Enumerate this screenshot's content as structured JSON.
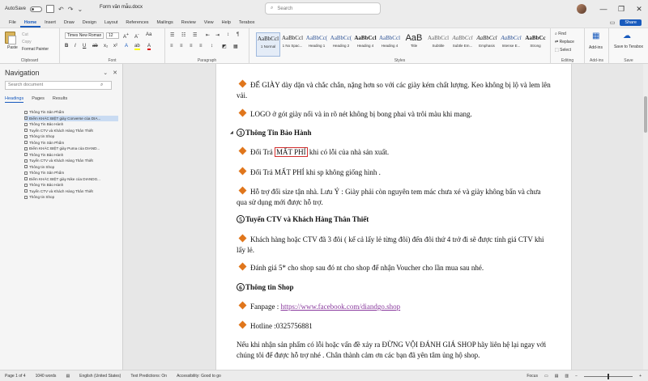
{
  "titlebar": {
    "autosave": "AutoSave",
    "toggle": "Off",
    "doc_title": "Form văn mẫu.docx",
    "search_placeholder": "Search"
  },
  "tabs": [
    {
      "label": "File"
    },
    {
      "label": "Home",
      "active": true
    },
    {
      "label": "Insert"
    },
    {
      "label": "Draw"
    },
    {
      "label": "Design"
    },
    {
      "label": "Layout"
    },
    {
      "label": "References"
    },
    {
      "label": "Mailings"
    },
    {
      "label": "Review"
    },
    {
      "label": "View"
    },
    {
      "label": "Help"
    },
    {
      "label": "Terabox"
    }
  ],
  "share_label": "Share",
  "ribbon": {
    "clipboard": {
      "paste": "Paste",
      "cut": "Cut",
      "copy": "Copy",
      "format_painter": "Format Painter",
      "label": "Clipboard"
    },
    "font": {
      "name": "Times New Roman",
      "size": "12",
      "label": "Font"
    },
    "paragraph": {
      "label": "Paragraph"
    },
    "styles": {
      "label": "Styles",
      "items": [
        {
          "preview": "AaBbCcl",
          "name": "1 Normal"
        },
        {
          "preview": "AaBbCcl",
          "name": "1 No Spac..."
        },
        {
          "preview": "AaBbCc(",
          "name": "Heading 1",
          "heading": true
        },
        {
          "preview": "AaBbCc(",
          "name": "Heading 2",
          "heading": true
        },
        {
          "preview": "AaBbCcl",
          "name": "Heading 4"
        },
        {
          "preview": "AaBbCcl",
          "name": "Heading 4"
        },
        {
          "preview": "AaB",
          "name": "Title"
        },
        {
          "preview": "AaBbCcl",
          "name": "Subtitle"
        },
        {
          "preview": "AaBbCcl",
          "name": "Subtle Em..."
        },
        {
          "preview": "AaBbCcl",
          "name": "Emphasis"
        },
        {
          "preview": "AaBbCcl",
          "name": "Intense E..."
        },
        {
          "preview": "AaBbCc",
          "name": "Strong"
        }
      ]
    },
    "editing": {
      "find": "Find",
      "replace": "Replace",
      "select": "Select",
      "label": "Editing"
    },
    "addins": {
      "label": "Add-ins",
      "text": "Add-ins"
    },
    "save": {
      "text": "Save to Terabox",
      "label": "Save"
    }
  },
  "nav": {
    "title": "Navigation",
    "search_placeholder": "Search document",
    "tabs": [
      {
        "label": "Headings",
        "active": true
      },
      {
        "label": "Pages"
      },
      {
        "label": "Results"
      }
    ],
    "items": [
      {
        "label": "Thông Tin Sản Phẩm"
      },
      {
        "label": "Điểm KHÁC BIỆT giày Converse của DIA...",
        "highlight": true
      },
      {
        "label": "Thông Tin Bảo Hành"
      },
      {
        "label": "Tuyển CTV và Khách Hàng Thân Thiết"
      },
      {
        "label": "Thông tin Shop"
      },
      {
        "label": "Thông Tin Sản Phẩm"
      },
      {
        "label": "Điểm KHÁC BIỆT giày Puma của DIAND..."
      },
      {
        "label": "Thông Tin Bảo Hành"
      },
      {
        "label": "Tuyển CTV và Khách Hàng Thân Thiết"
      },
      {
        "label": "Thông tin Shop"
      },
      {
        "label": "Thông Tin Sản Phẩm"
      },
      {
        "label": "Điểm KHÁC BIỆT giày Nike của DIANDG..."
      },
      {
        "label": "Thông Tin Bảo Hành"
      },
      {
        "label": "Tuyển CTV và Khách Hàng Thân Thiết"
      },
      {
        "label": "Thông tin Shop"
      }
    ]
  },
  "document": {
    "p1": "ĐẾ GIÀY dày dặn và chắc chắn, nặng hơn so với các giày kém chất lượng. Keo không bị lộ và lem lên vải.",
    "p2": "LOGO ở gót giày nổi và in rõ nét không bị bong phai và trôi màu khi mang.",
    "h3_num": "3",
    "h3": "Thông Tin Bảo Hành",
    "p3a": "Đổi Trả",
    "p3b": "MẤT PHÍ",
    "p3c": "khi có lỗi của nhà sản xuất.",
    "p4": "Đổi Trả MẤT PHÍ khi sp không giống hình .",
    "p5": "Hỗ trợ đổi size tận nhà. Lưu Ý : Giày phải còn nguyên tem mác chưa xé và giày không bẩn và chưa qua sử dụng mới được hỗ trợ.",
    "h4_num": "5",
    "h4": "Tuyển CTV và Khách Hàng Thân Thiết",
    "p6": "Khách hàng hoặc CTV đã 3 đôi ( kể cả lấy lẻ từng đôi) đến đôi thứ 4 trở đi sẽ được tính giá CTV khi lấy lẻ.",
    "p7": "Đánh giá 5* cho shop sau đó nt cho shop để nhận Voucher cho lần mua sau nhé.",
    "h5_num": "6",
    "h5": "Thông tin Shop",
    "p8_label": "Fanpage : ",
    "p8_link": "https://www.facebook.com/diandgo.shop",
    "p9": "Hotline :0325756881",
    "p10": "Nếu khi nhận sản phẩm có lỗi hoặc vấn đề xảy ra ĐỪNG VỘI ĐÁNH GIÁ SHOP hãy liên hệ lại ngay với chúng tôi để được hỗ trợ nhé . Chân thành cảm ơn các bạn đã yên tâm ủng hộ shop."
  },
  "status": {
    "page": "Page 1 of 4",
    "words": "1040 words",
    "language": "English (United States)",
    "predictions": "Text Predictions: On",
    "accessibility": "Accessibility: Good to go",
    "focus": "Focus"
  },
  "colors": {
    "accent": "#185abd",
    "bullet": "#e0761c",
    "highlight_box": "#d32f2f",
    "link": "#8a3a9e"
  }
}
